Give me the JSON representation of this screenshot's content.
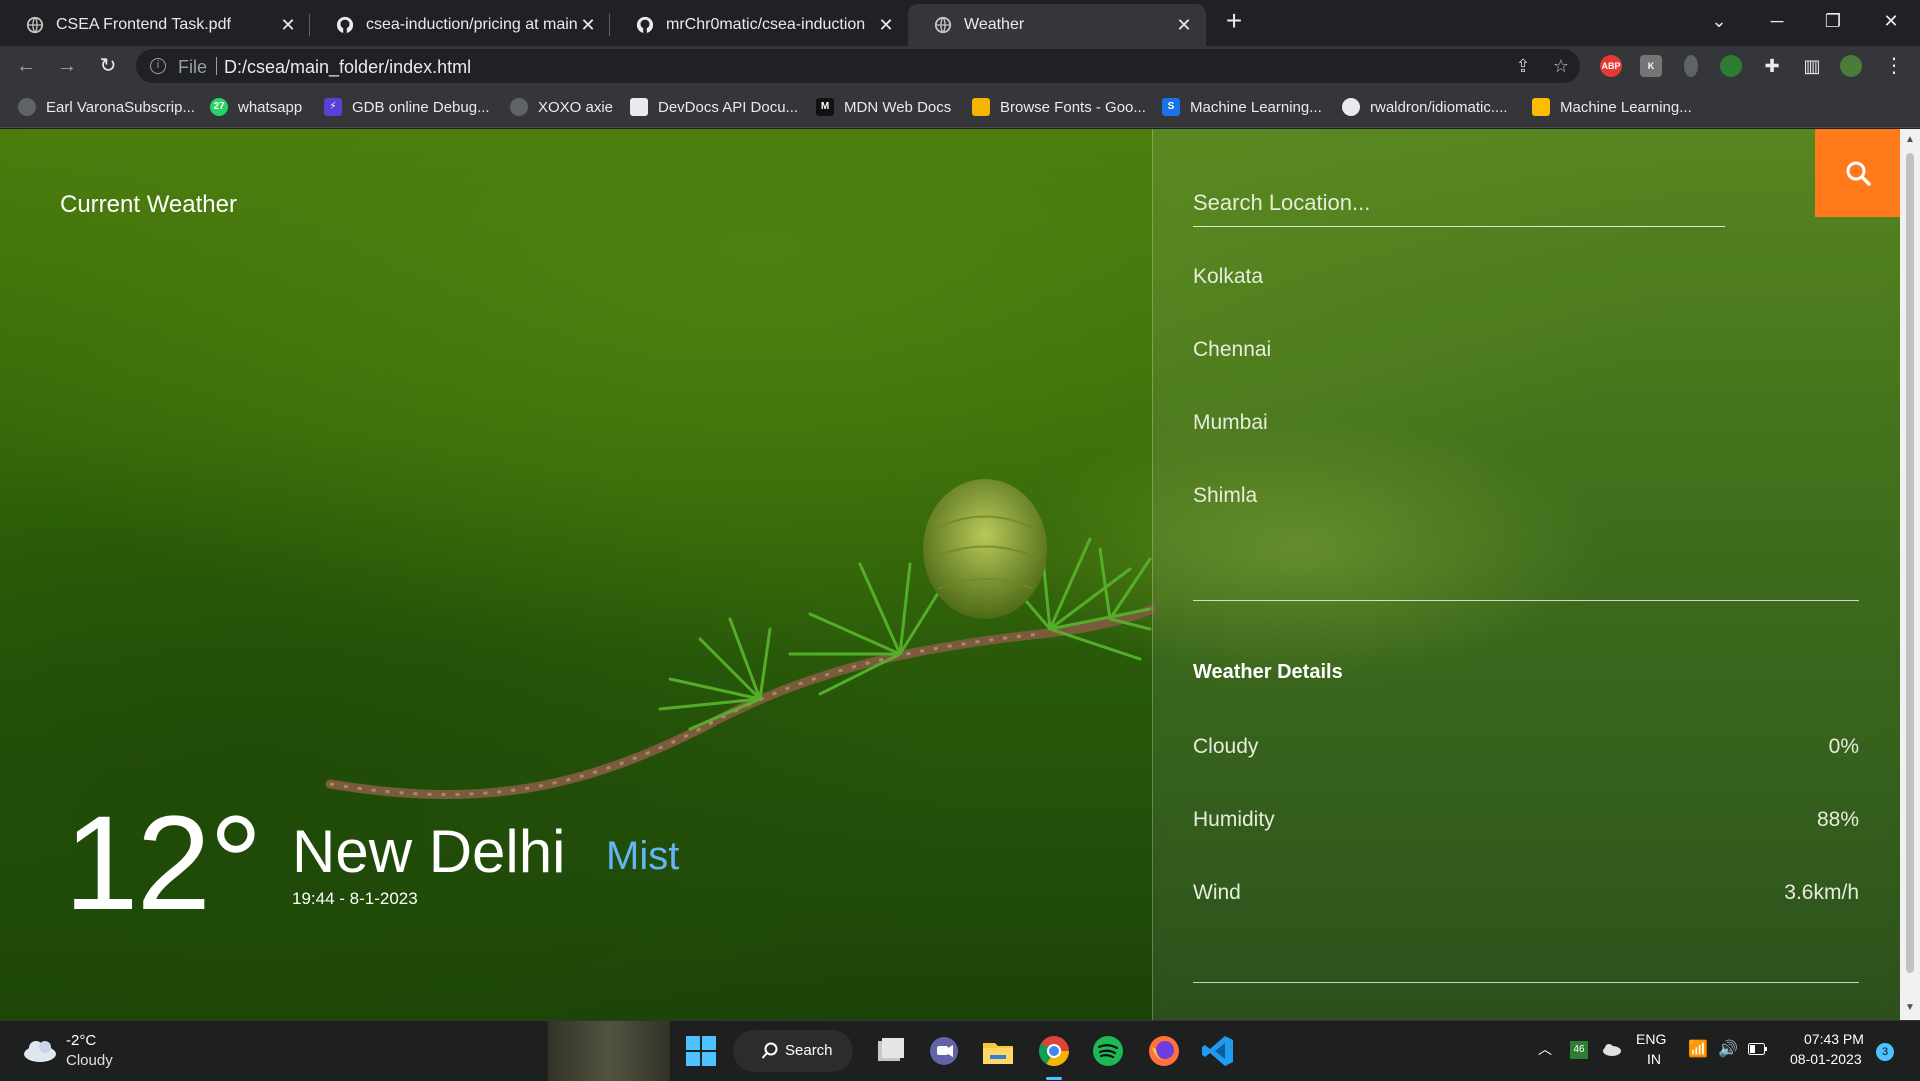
{
  "browser": {
    "tabs": [
      {
        "title": "CSEA Frontend Task.pdf",
        "icon": "globe-icon",
        "active": false
      },
      {
        "title": "csea-induction/pricing at main · r",
        "icon": "github-icon",
        "active": false
      },
      {
        "title": "mrChr0matic/csea-induction",
        "icon": "github-icon",
        "active": false
      },
      {
        "title": "Weather",
        "icon": "globe-icon",
        "active": true
      }
    ],
    "address": {
      "scheme": "File",
      "url": "D:/csea/main_folder/index.html"
    },
    "extensions": [
      {
        "name": "adblock-plus-icon",
        "label": "ABP",
        "color": "#e53935"
      },
      {
        "name": "extension-k-icon",
        "label": "K",
        "color": "#757575"
      },
      {
        "name": "extension-bulb-icon",
        "label": "",
        "color": "#5f6368"
      },
      {
        "name": "extension-tree-icon",
        "label": "",
        "color": "#2e7d32"
      },
      {
        "name": "extensions-puzzle-icon",
        "label": "",
        "color": "#35363a"
      }
    ],
    "bookmarks": [
      {
        "label": "Earl VaronaSubscrip...",
        "icon": "globe-icon",
        "color": "#5f6368",
        "glyph": ""
      },
      {
        "label": "whatsapp",
        "icon": "whatsapp-icon",
        "color": "#25d366",
        "glyph": "27"
      },
      {
        "label": "GDB online Debug...",
        "icon": "gdb-icon",
        "color": "#5b3fd9",
        "glyph": "⚡"
      },
      {
        "label": "XOXO axie",
        "icon": "globe-icon",
        "color": "#5f6368",
        "glyph": ""
      },
      {
        "label": "DevDocs API Docu...",
        "icon": "devdocs-icon",
        "color": "#e8eaed",
        "glyph": ""
      },
      {
        "label": "MDN Web Docs",
        "icon": "mdn-icon",
        "color": "#111111",
        "glyph": "M"
      },
      {
        "label": "Browse Fonts - Goo...",
        "icon": "google-fonts-icon",
        "color": "#f4b400",
        "glyph": ""
      },
      {
        "label": "Machine Learning...",
        "icon": "s-icon",
        "color": "#1a73e8",
        "glyph": "S"
      },
      {
        "label": "rwaldron/idiomatic....",
        "icon": "github-icon",
        "color": "#e8eaed",
        "glyph": ""
      },
      {
        "label": "Machine Learning...",
        "icon": "google-drive-icon",
        "color": "#fbbc04",
        "glyph": ""
      }
    ]
  },
  "app": {
    "title": "Current Weather",
    "temperature": "12°",
    "city": "New Delhi",
    "datetime": "19:44 - 8-1-2023",
    "condition": "Mist",
    "search_placeholder": "Search Location...",
    "cities": [
      "Kolkata",
      "Chennai",
      "Mumbai",
      "Shimla"
    ],
    "details_heading": "Weather Details",
    "details": [
      {
        "label": "Cloudy",
        "value": "0%"
      },
      {
        "label": "Humidity",
        "value": "88%"
      },
      {
        "label": "Wind",
        "value": "3.6km/h"
      }
    ],
    "colors": {
      "accent": "#ff7a1a",
      "condition": "#64b5f6"
    }
  },
  "taskbar": {
    "weather": {
      "temp": "-2°C",
      "condition": "Cloudy"
    },
    "search_label": "Search",
    "apps": [
      "windows-start-icon",
      "task-view-icon",
      "teams-chat-icon",
      "file-explorer-icon",
      "chrome-icon",
      "spotify-icon",
      "firefox-icon",
      "vscode-icon"
    ],
    "tray": {
      "badge": "46",
      "language_top": "ENG",
      "language_bottom": "IN",
      "time": "07:43 PM",
      "date": "08-01-2023",
      "notifications": "3"
    }
  }
}
